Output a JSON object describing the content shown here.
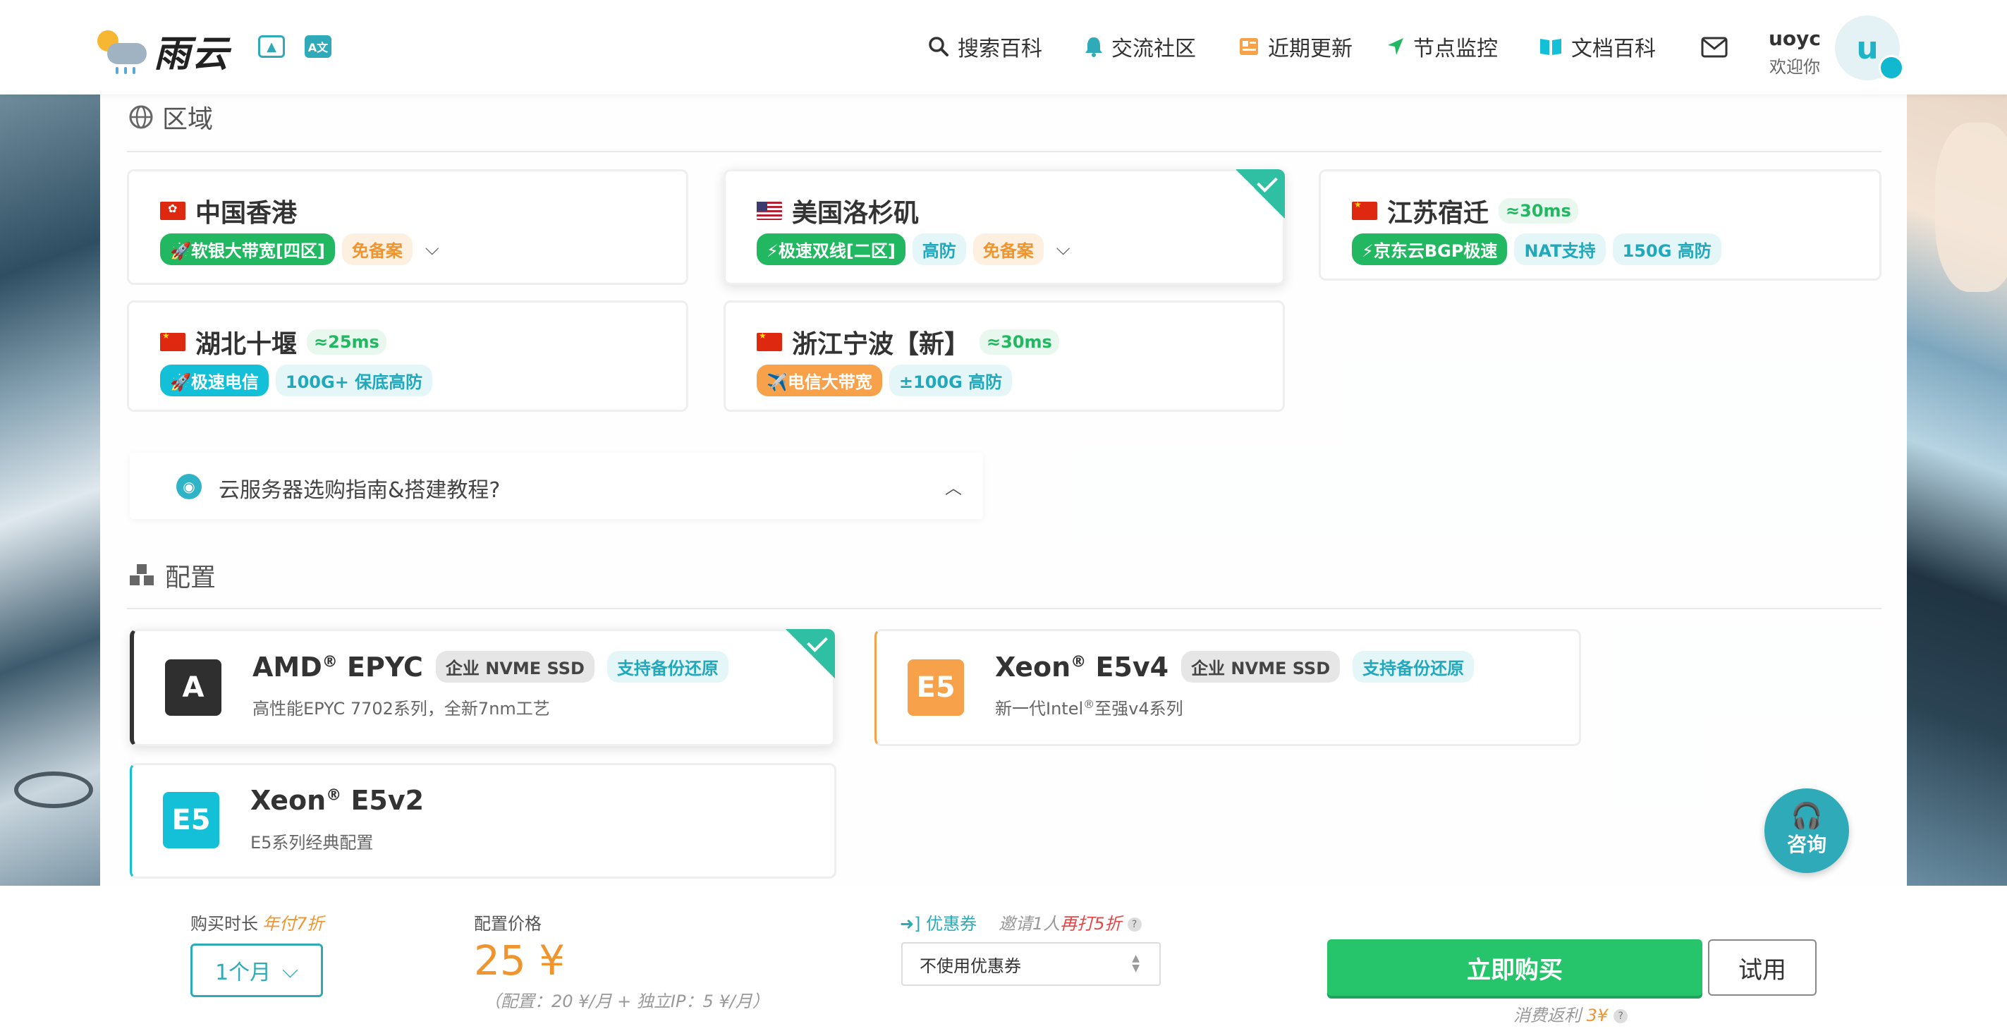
{
  "header": {
    "logo_text": "雨云",
    "nav": [
      {
        "label": "搜索百科",
        "icon": "search-icon"
      },
      {
        "label": "交流社区",
        "icon": "bell-icon"
      },
      {
        "label": "近期更新",
        "icon": "newspaper-icon"
      },
      {
        "label": "节点监控",
        "icon": "location-arrow-icon"
      },
      {
        "label": "文档百科",
        "icon": "book-icon"
      }
    ],
    "user_name": "uoyc",
    "user_greeting": "欢迎你",
    "avatar_letter": "u"
  },
  "region": {
    "title": "区域",
    "cards": [
      {
        "name": "中国香港",
        "flag": "hk",
        "latency": "",
        "tags": [
          "🚀软银大带宽[四区]",
          "免备案"
        ],
        "selected": false
      },
      {
        "name": "美国洛杉矶",
        "flag": "us",
        "latency": "",
        "tags": [
          "⚡极速双线[二区]",
          "高防",
          "免备案"
        ],
        "selected": true
      },
      {
        "name": "江苏宿迁",
        "flag": "cn",
        "latency": "≈30ms",
        "tags": [
          "⚡京东云BGP极速",
          "NAT支持",
          "150G 高防"
        ],
        "selected": false
      },
      {
        "name": "湖北十堰",
        "flag": "cn",
        "latency": "≈25ms",
        "tags": [
          "🚀极速电信",
          "100G+ 保底高防"
        ],
        "selected": false
      },
      {
        "name": "浙江宁波【新】",
        "flag": "cn",
        "latency": "≈30ms",
        "tags": [
          "✈️电信大带宽",
          "±100G 高防"
        ],
        "selected": false
      }
    ]
  },
  "guide": {
    "text": "云服务器选购指南&搭建教程?"
  },
  "config": {
    "title": "配置",
    "cards": [
      {
        "icon": "A",
        "name": "AMD",
        "suffix": "EPYC",
        "badges": [
          "企业 NVME SSD",
          "支持备份还原"
        ],
        "desc": "高性能EPYC 7702系列，全新7nm工艺",
        "selected": true
      },
      {
        "icon": "E5",
        "name": "Xeon",
        "suffix": "E5v4",
        "badges": [
          "企业 NVME SSD",
          "支持备份还原"
        ],
        "desc_pre": "新一代Intel",
        "desc_post": "至强v4系列",
        "selected": false
      },
      {
        "icon": "E5",
        "name": "Xeon",
        "suffix": "E5v2",
        "badges": [],
        "desc": "E5系列经典配置",
        "selected": false
      }
    ],
    "reg": "®"
  },
  "consult_label": "咨询",
  "bottom": {
    "duration_label": "购买时长",
    "duration_discount": "年付7折",
    "duration_value": "1个月",
    "price_label": "配置价格",
    "price": "25 ¥",
    "price_note": "（配置：20 ¥/月 + 独立IP：5 ¥/月）",
    "coupon_label": "优惠券",
    "invite_pre": "邀请1人",
    "invite_hl": "再打5折",
    "coupon_select": "不使用优惠券",
    "buy_label": "立即购买",
    "try_label": "试用",
    "rebate_pre": "消费返利",
    "rebate_value": "3¥"
  },
  "colors": {
    "accent": "#2eaab8",
    "buy": "#26c56b",
    "orange": "#f0952e",
    "select_corner": "#2fbfa2"
  }
}
